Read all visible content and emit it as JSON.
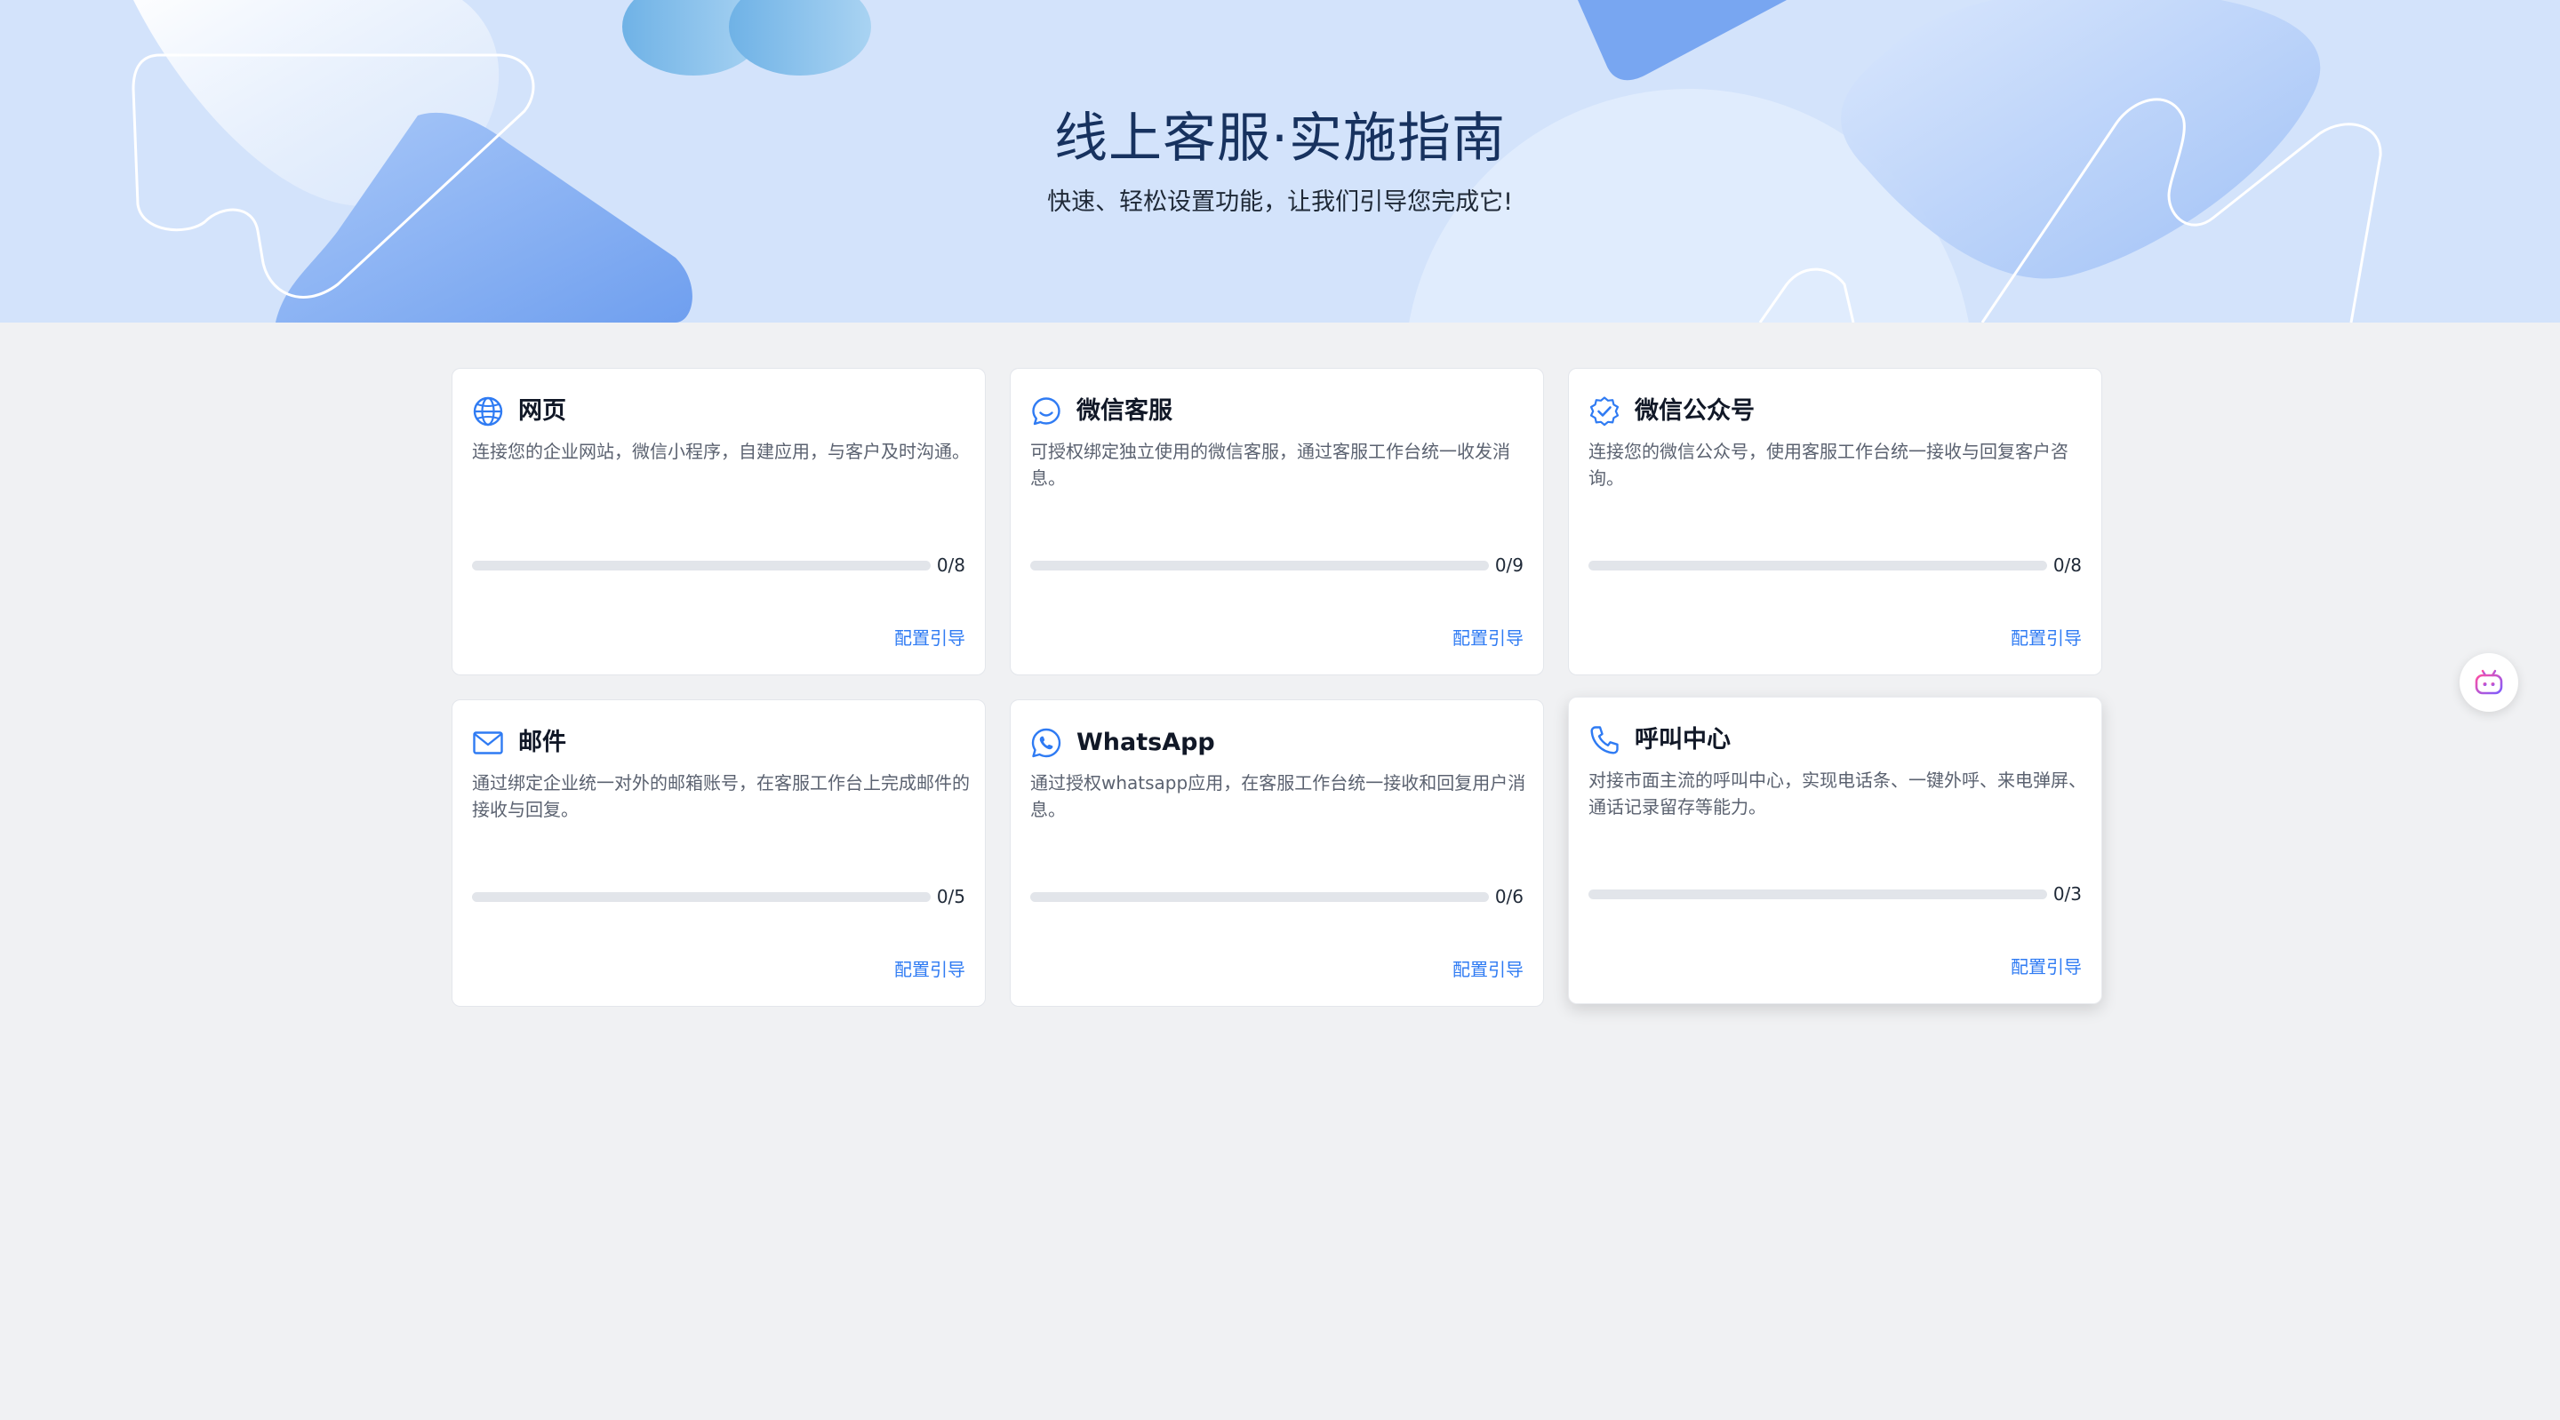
{
  "banner": {
    "title": "线上客服·实施指南",
    "subtitle": "快速、轻松设置功能，让我们引导您完成它!"
  },
  "colors": {
    "accent": "#2f7bf3",
    "banner_bg": "#d3e3fb",
    "page_bg": "#f0f1f3",
    "progress_track": "#e2e5ea"
  },
  "cards": [
    {
      "icon": "globe-icon",
      "title": "网页",
      "description": "连接您的企业网站，微信小程序，自建应用，与客户及时沟通。",
      "progress_text": "0/8",
      "progress": 0,
      "link": "配置引导"
    },
    {
      "icon": "chat-smile-icon",
      "title": "微信客服",
      "description": "可授权绑定独立使用的微信客服，通过客服工作台统一收发消息。",
      "progress_text": "0/9",
      "progress": 0,
      "link": "配置引导"
    },
    {
      "icon": "verified-badge-icon",
      "title": "微信公众号",
      "description": "连接您的微信公众号，使用客服工作台统一接收与回复客户咨询。",
      "progress_text": "0/8",
      "progress": 0,
      "link": "配置引导"
    },
    {
      "icon": "mail-icon",
      "title": "邮件",
      "description": "通过绑定企业统一对外的邮箱账号，在客服工作台上完成邮件的接收与回复。",
      "progress_text": "0/5",
      "progress": 0,
      "link": "配置引导"
    },
    {
      "icon": "whatsapp-icon",
      "title": "WhatsApp",
      "description": "通过授权whatsapp应用，在客服工作台统一接收和回复用户消息。",
      "progress_text": "0/6",
      "progress": 0,
      "link": "配置引导"
    },
    {
      "icon": "phone-icon",
      "title": "呼叫中心",
      "description": "对接市面主流的呼叫中心，实现电话条、一键外呼、来电弹屏、通话记录留存等能力。",
      "progress_text": "0/3",
      "progress": 0,
      "link": "配置引导"
    }
  ],
  "assistant": {
    "icon": "robot-assistant-icon"
  }
}
